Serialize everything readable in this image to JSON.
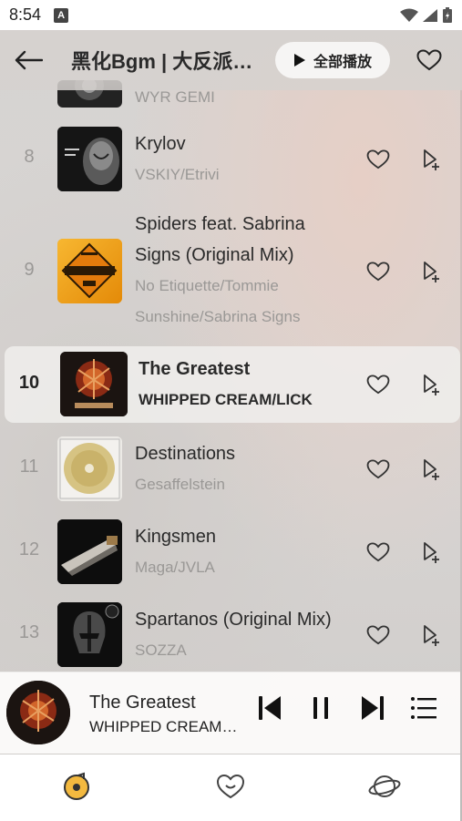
{
  "status": {
    "time": "8:54",
    "notification_icon": "A"
  },
  "header": {
    "title": "黑化Bgm | 大反派…",
    "play_all_label": "全部播放"
  },
  "partial_row": {
    "artist": "WYR GEMI"
  },
  "songs": [
    {
      "num": "8",
      "title": "Krylov",
      "artist": "VSKIY/Etrivi",
      "cover_color": "#1b1b1b"
    },
    {
      "num": "9",
      "title": "Spiders feat. Sabrina Signs (Original Mix)",
      "title_line1": "Spiders feat. Sabrina",
      "title_line2": "Signs (Original Mix)",
      "artist_line1": "No Etiquette/Tommie",
      "artist_line2": "Sunshine/Sabrina Signs",
      "cover_color": "#f2a41a"
    },
    {
      "num": "10",
      "title": "The Greatest",
      "artist": "WHIPPED CREAM/LICK",
      "cover_color": "#1c1512",
      "active": true
    },
    {
      "num": "11",
      "title": "Destinations",
      "artist": "Gesaffelstein",
      "cover_color": "#e8e6e2"
    },
    {
      "num": "12",
      "title": "Kingsmen",
      "artist": "Maga/JVLA",
      "cover_color": "#111111"
    },
    {
      "num": "13",
      "title": "Spartanos (Original Mix)",
      "artist": "SOZZA",
      "cover_color": "#0e0e0e"
    }
  ],
  "player": {
    "title": "The Greatest",
    "artist": "WHIPPED CREAM/…"
  },
  "colors": {
    "accent": "#f3b93f",
    "icon": "#333333"
  }
}
